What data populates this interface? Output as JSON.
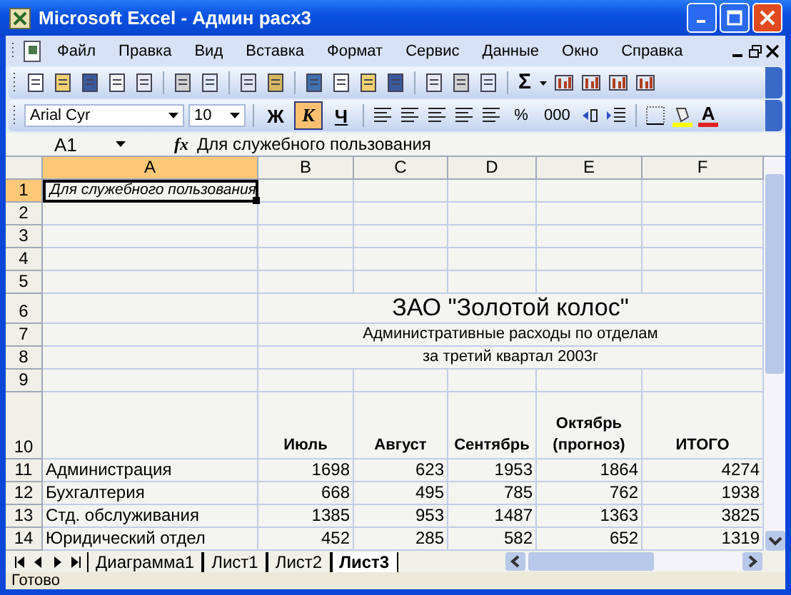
{
  "window": {
    "title": "Microsoft Excel - Админ расх3"
  },
  "menu": [
    "Файл",
    "Правка",
    "Вид",
    "Вставка",
    "Формат",
    "Сервис",
    "Данные",
    "Окно",
    "Справка"
  ],
  "standard_toolbar": {
    "autosum": "Σ"
  },
  "formatting_toolbar": {
    "font": "Arial Cyr",
    "size": "10",
    "styles": [
      {
        "label": "Ж",
        "kind": "bold",
        "on": false
      },
      {
        "label": "К",
        "kind": "italic",
        "on": true
      },
      {
        "label": "Ч",
        "kind": "underline",
        "on": false
      }
    ],
    "number_buttons": [
      "%",
      "000"
    ],
    "font_color_label": "A"
  },
  "formula_bar": {
    "name_box": "A1",
    "fx": "fx",
    "formula": "Для служебного пользования"
  },
  "columns": [
    {
      "label": "A",
      "selected": true
    },
    {
      "label": "B",
      "selected": false
    },
    {
      "label": "C",
      "selected": false
    },
    {
      "label": "D",
      "selected": false
    },
    {
      "label": "E",
      "selected": false
    },
    {
      "label": "F",
      "selected": false
    }
  ],
  "rows": [
    {
      "num": "1",
      "kind": "note",
      "selected": true,
      "label": "Для служебного пользования"
    },
    {
      "num": "2",
      "kind": "blank",
      "selected": false
    },
    {
      "num": "3",
      "kind": "blank",
      "selected": false
    },
    {
      "num": "4",
      "kind": "blank",
      "selected": false
    },
    {
      "num": "5",
      "kind": "blank",
      "selected": false
    },
    {
      "num": "6",
      "kind": "title",
      "selected": false,
      "text": "ЗАО \"Золотой колос\""
    },
    {
      "num": "7",
      "kind": "subtitle",
      "selected": false,
      "text": "Административные расходы по отделам"
    },
    {
      "num": "8",
      "kind": "subtitle",
      "selected": false,
      "text": "за третий квартал 2003г"
    },
    {
      "num": "9",
      "kind": "blank",
      "selected": false
    },
    {
      "num": "10",
      "kind": "header",
      "selected": false,
      "values": [
        "Июль",
        "Август",
        "Сентябрь",
        "Октябрь (прогноз)",
        "ИТОГО"
      ]
    },
    {
      "num": "11",
      "kind": "data",
      "selected": false,
      "label": "Администрация",
      "values": [
        "1698",
        "623",
        "1953",
        "1864",
        "4274"
      ]
    },
    {
      "num": "12",
      "kind": "data",
      "selected": false,
      "label": "Бухгалтерия",
      "values": [
        "668",
        "495",
        "785",
        "762",
        "1938"
      ]
    },
    {
      "num": "13",
      "kind": "data",
      "selected": false,
      "label": "Стд. обслуживания",
      "values": [
        "1385",
        "953",
        "1487",
        "1363",
        "3825"
      ]
    },
    {
      "num": "14",
      "kind": "data",
      "selected": false,
      "label": "Юридический отдел",
      "values": [
        "452",
        "285",
        "582",
        "652",
        "1319"
      ]
    }
  ],
  "sheet_tabs": [
    {
      "label": "Диаграмма1",
      "selected": false
    },
    {
      "label": "Лист1",
      "selected": false
    },
    {
      "label": "Лист2",
      "selected": false
    },
    {
      "label": "Лист3",
      "selected": true
    }
  ],
  "status_bar": "Готово"
}
